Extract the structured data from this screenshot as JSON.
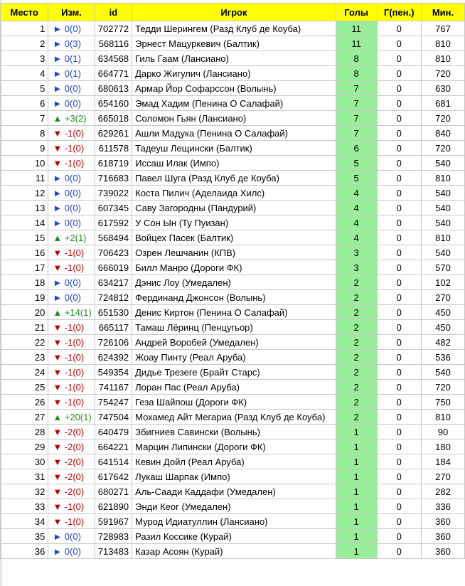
{
  "columns": [
    "Место",
    "Изм.",
    "id",
    "Игрок",
    "Голы",
    "Г(пен.)",
    "Мин."
  ],
  "rows": [
    {
      "place": "1",
      "change": "► 0(0)",
      "dir": "none",
      "id": "702772",
      "player": "Тедди Шерингем (Разд Клуб де Коуба)",
      "goals": "11",
      "pen": "0",
      "min": "767"
    },
    {
      "place": "2",
      "change": "► 0(3)",
      "dir": "none",
      "id": "568116",
      "player": "Эрнест Мацуркевич (Балтик)",
      "goals": "11",
      "pen": "0",
      "min": "810"
    },
    {
      "place": "3",
      "change": "► 0(1)",
      "dir": "none",
      "id": "634568",
      "player": "Гиль Гаам (Лансиано)",
      "goals": "8",
      "pen": "0",
      "min": "810"
    },
    {
      "place": "4",
      "change": "► 0(1)",
      "dir": "none",
      "id": "664771",
      "player": "Дарко Жигулич (Лансиано)",
      "goals": "8",
      "pen": "0",
      "min": "720"
    },
    {
      "place": "5",
      "change": "► 0(0)",
      "dir": "none",
      "id": "680613",
      "player": "Армар Йор Софарссон (Волынь)",
      "goals": "7",
      "pen": "0",
      "min": "630"
    },
    {
      "place": "6",
      "change": "► 0(0)",
      "dir": "none",
      "id": "654160",
      "player": "Эмад Хадим (Пенина О Салафай)",
      "goals": "7",
      "pen": "0",
      "min": "681"
    },
    {
      "place": "7",
      "change": "▲ +3(2)",
      "dir": "up",
      "id": "665018",
      "player": "Соломон Гьян (Лансиано)",
      "goals": "7",
      "pen": "0",
      "min": "720"
    },
    {
      "place": "8",
      "change": "▼ -1(0)",
      "dir": "down",
      "id": "629261",
      "player": "Ашли Мадука (Пенина О Салафай)",
      "goals": "7",
      "pen": "0",
      "min": "840"
    },
    {
      "place": "9",
      "change": "▼ -1(0)",
      "dir": "down",
      "id": "611578",
      "player": "Тадеуш Лещински (Балтик)",
      "goals": "6",
      "pen": "0",
      "min": "720"
    },
    {
      "place": "10",
      "change": "▼ -1(0)",
      "dir": "down",
      "id": "618719",
      "player": "Иссаш Илак (Импо)",
      "goals": "5",
      "pen": "0",
      "min": "540"
    },
    {
      "place": "11",
      "change": "► 0(0)",
      "dir": "none",
      "id": "716683",
      "player": "Павел Шуга (Разд Клуб де Коуба)",
      "goals": "5",
      "pen": "0",
      "min": "810"
    },
    {
      "place": "12",
      "change": "► 0(0)",
      "dir": "none",
      "id": "739022",
      "player": "Коста Пилич (Аделаида Хилс)",
      "goals": "4",
      "pen": "0",
      "min": "540"
    },
    {
      "place": "13",
      "change": "► 0(0)",
      "dir": "none",
      "id": "607345",
      "player": "Саву Загородны (Пандурий)",
      "goals": "4",
      "pen": "0",
      "min": "540"
    },
    {
      "place": "14",
      "change": "► 0(0)",
      "dir": "none",
      "id": "617592",
      "player": "У Сон Ын (Ту Пуизан)",
      "goals": "4",
      "pen": "0",
      "min": "540"
    },
    {
      "place": "15",
      "change": "▲ +2(1)",
      "dir": "up",
      "id": "568494",
      "player": "Войцех Пасек (Балтик)",
      "goals": "4",
      "pen": "0",
      "min": "810"
    },
    {
      "place": "16",
      "change": "▼ -1(0)",
      "dir": "down",
      "id": "706423",
      "player": "Озрен Лешчанин (КПВ)",
      "goals": "3",
      "pen": "0",
      "min": "540"
    },
    {
      "place": "17",
      "change": "▼ -1(0)",
      "dir": "down",
      "id": "666019",
      "player": "Билл Манро (Дороги ФК)",
      "goals": "3",
      "pen": "0",
      "min": "570"
    },
    {
      "place": "18",
      "change": "► 0(0)",
      "dir": "none",
      "id": "634217",
      "player": "Дэнис Лоу (Умедален)",
      "goals": "2",
      "pen": "0",
      "min": "102"
    },
    {
      "place": "19",
      "change": "► 0(0)",
      "dir": "none",
      "id": "724812",
      "player": "Фердинанд Джонсон (Волынь)",
      "goals": "2",
      "pen": "0",
      "min": "270"
    },
    {
      "place": "20",
      "change": "▲ +14(1)",
      "dir": "up",
      "id": "651530",
      "player": "Денис Киртон (Пенина О Салафай)",
      "goals": "2",
      "pen": "0",
      "min": "450"
    },
    {
      "place": "21",
      "change": "▼ -1(0)",
      "dir": "down",
      "id": "665117",
      "player": "Тамаш Лёринц (Пенцугьор)",
      "goals": "2",
      "pen": "0",
      "min": "450"
    },
    {
      "place": "22",
      "change": "▼ -1(0)",
      "dir": "down",
      "id": "726106",
      "player": "Андрей Воробей (Умедален)",
      "goals": "2",
      "pen": "0",
      "min": "482"
    },
    {
      "place": "23",
      "change": "▼ -1(0)",
      "dir": "down",
      "id": "624392",
      "player": "Жоау Пинту (Реал Аруба)",
      "goals": "2",
      "pen": "0",
      "min": "536"
    },
    {
      "place": "24",
      "change": "▼ -1(0)",
      "dir": "down",
      "id": "549354",
      "player": "Дидье Трезеге (Брайт Старс)",
      "goals": "2",
      "pen": "0",
      "min": "540"
    },
    {
      "place": "25",
      "change": "▼ -1(0)",
      "dir": "down",
      "id": "741167",
      "player": "Лоран Пас (Реал Аруба)",
      "goals": "2",
      "pen": "0",
      "min": "720"
    },
    {
      "place": "26",
      "change": "▼ -1(0)",
      "dir": "down",
      "id": "754247",
      "player": "Геза Шайпош (Дороги ФК)",
      "goals": "2",
      "pen": "0",
      "min": "750"
    },
    {
      "place": "27",
      "change": "▲ +20(1)",
      "dir": "up",
      "id": "747504",
      "player": "Мохамед Айт Мегариа (Разд Клуб де Коуба)",
      "goals": "2",
      "pen": "0",
      "min": "810"
    },
    {
      "place": "28",
      "change": "▼ -2(0)",
      "dir": "down",
      "id": "640479",
      "player": "Збигниев Савински (Волынь)",
      "goals": "1",
      "pen": "0",
      "min": "90"
    },
    {
      "place": "29",
      "change": "▼ -2(0)",
      "dir": "down",
      "id": "664221",
      "player": "Марцин Липински (Дороги ФК)",
      "goals": "1",
      "pen": "0",
      "min": "180"
    },
    {
      "place": "30",
      "change": "▼ -2(0)",
      "dir": "down",
      "id": "641514",
      "player": "Кевин Дойл (Реал Аруба)",
      "goals": "1",
      "pen": "0",
      "min": "184"
    },
    {
      "place": "31",
      "change": "▼ -2(0)",
      "dir": "down",
      "id": "617642",
      "player": "Лукаш Шарпак (Импо)",
      "goals": "1",
      "pen": "0",
      "min": "270"
    },
    {
      "place": "32",
      "change": "▼ -2(0)",
      "dir": "down",
      "id": "680271",
      "player": "Аль-Саади Каддафи (Умедален)",
      "goals": "1",
      "pen": "0",
      "min": "282"
    },
    {
      "place": "33",
      "change": "▼ -1(0)",
      "dir": "down",
      "id": "621890",
      "player": "Энди Кеог (Умедален)",
      "goals": "1",
      "pen": "0",
      "min": "336"
    },
    {
      "place": "34",
      "change": "▼ -1(0)",
      "dir": "down",
      "id": "591967",
      "player": "Мурод Идиатуллин (Лансиано)",
      "goals": "1",
      "pen": "0",
      "min": "360"
    },
    {
      "place": "35",
      "change": "► 0(0)",
      "dir": "none",
      "id": "728983",
      "player": "Разил Коссике (Курай)",
      "goals": "1",
      "pen": "0",
      "min": "360"
    },
    {
      "place": "36",
      "change": "► 0(0)",
      "dir": "none",
      "id": "713483",
      "player": "Казар Асоян (Курай)",
      "goals": "1",
      "pen": "0",
      "min": "360"
    }
  ]
}
